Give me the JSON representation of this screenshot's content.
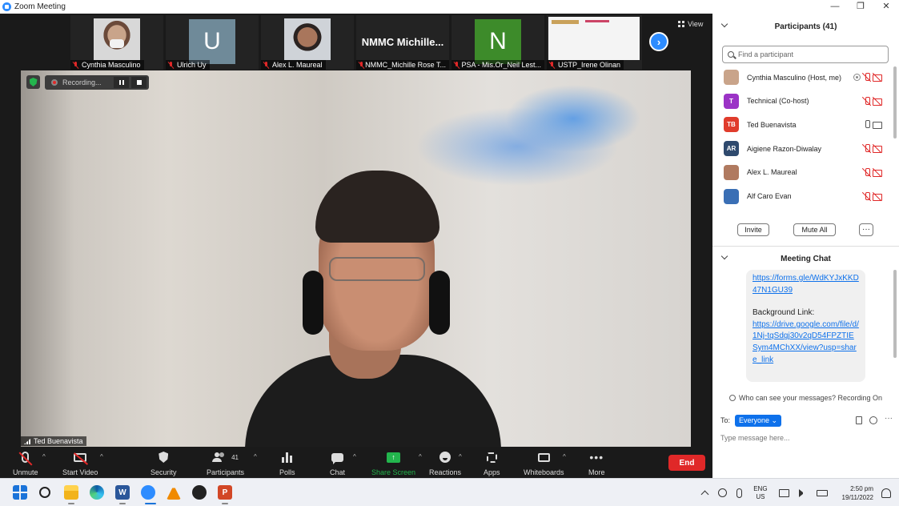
{
  "window": {
    "title": "Zoom Meeting",
    "controls": [
      "—",
      "❐",
      "✕"
    ]
  },
  "thumbnails": [
    {
      "name": "Cynthia Masculino",
      "kind": "photo-mask"
    },
    {
      "name": "Ulrich Uy",
      "kind": "letter",
      "letter": "U",
      "color": "#6f8a99"
    },
    {
      "name": "Alex L. Maureal",
      "kind": "photo"
    },
    {
      "name": "NMMC_Michille Rose T...",
      "kind": "name",
      "label": "NMMC  Michille..."
    },
    {
      "name": "PSA - Mis.Or_Neil Lest...",
      "kind": "letter",
      "letter": "N",
      "color": "#3d8b2a"
    },
    {
      "name": "USTP_Irene Olinan",
      "kind": "screen"
    }
  ],
  "view_label": "View",
  "recording": {
    "label": "Recording..."
  },
  "active_speaker": "Ted Buenavista",
  "toolbar": {
    "unmute": "Unmute",
    "start_video": "Start Video",
    "security": "Security",
    "participants": "Participants",
    "participants_count": "41",
    "polls": "Polls",
    "chat": "Chat",
    "share_screen": "Share Screen",
    "reactions": "Reactions",
    "apps": "Apps",
    "whiteboards": "Whiteboards",
    "more": "More",
    "end": "End"
  },
  "participants_panel": {
    "title": "Participants (41)",
    "search_placeholder": "Find a participant",
    "list": [
      {
        "name": "Cynthia Masculino (Host, me)",
        "initials": "",
        "color": "#c9a48a",
        "mic": "muted",
        "cam": "off",
        "recording": true
      },
      {
        "name": "Technical (Co-host)",
        "initials": "T",
        "color": "#9b33c6",
        "mic": "muted",
        "cam": "off",
        "recording": false
      },
      {
        "name": "Ted Buenavista",
        "initials": "TB",
        "color": "#e03c2c",
        "mic": "on",
        "cam": "on",
        "recording": false
      },
      {
        "name": "Aigiene Razon-Diwalay",
        "initials": "AR",
        "color": "#2f4a6e",
        "mic": "muted",
        "cam": "off",
        "recording": false
      },
      {
        "name": "Alex L. Maureal",
        "initials": "",
        "color": "#b07a60",
        "mic": "muted",
        "cam": "off",
        "recording": false
      },
      {
        "name": "Alf Caro Evan",
        "initials": "",
        "color": "#3a6fb5",
        "mic": "muted",
        "cam": "off",
        "recording": false
      }
    ],
    "invite": "Invite",
    "mute_all": "Mute All"
  },
  "chat_panel": {
    "title": "Meeting Chat",
    "message_link1": "https://forms.gle/WdKYJxKKD47N1GU39",
    "message_label": "Background Link:",
    "message_link2": "https://drive.google.com/file/d/1Nj-tqSdgj30v2qD54FPZTIESym4MChXX/view?usp=share_link",
    "visibility_note": "Who can see your messages? Recording On",
    "to_label": "To:",
    "to_value": "Everyone",
    "input_placeholder": "Type message here..."
  },
  "taskbar": {
    "apps": [
      "start",
      "search",
      "file-explorer",
      "edge",
      "word",
      "zoom",
      "vlc",
      "media-player",
      "powerpoint"
    ],
    "lang_line1": "ENG",
    "lang_line2": "US",
    "time": "2:50 pm",
    "date": "19/11/2022"
  }
}
